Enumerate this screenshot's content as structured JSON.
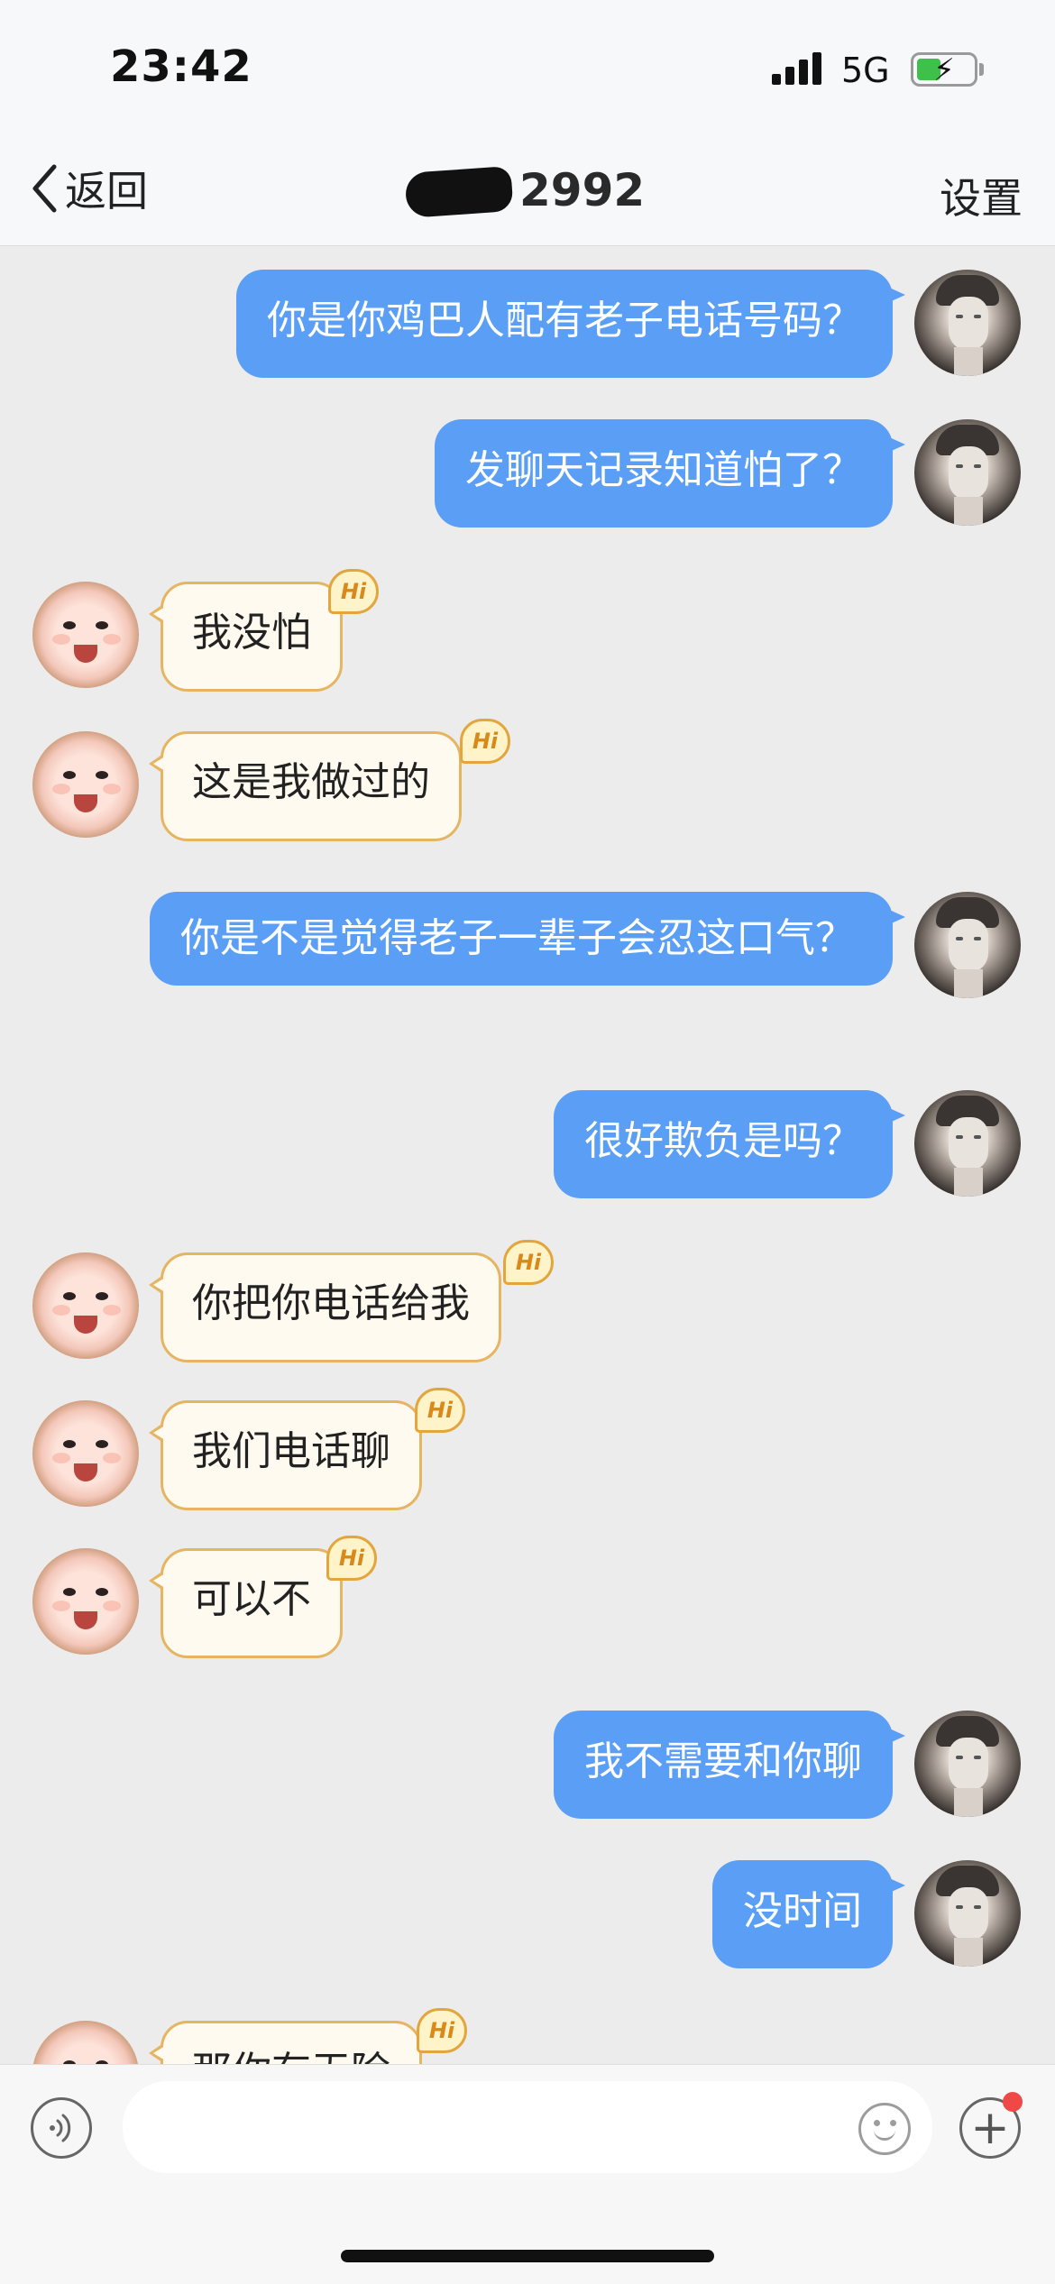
{
  "status_bar": {
    "time": "23:42",
    "network": "5G"
  },
  "nav": {
    "back_label": "返回",
    "title": "2992",
    "settings_label": "设置"
  },
  "messages": [
    {
      "side": "out",
      "text": "你是你鸡巴人配有老子电话号码？"
    },
    {
      "side": "out",
      "text": "发聊天记录知道怕了？"
    },
    {
      "side": "in",
      "text": "我没怕"
    },
    {
      "side": "in",
      "text": "这是我做过的"
    },
    {
      "side": "out",
      "text": "你是不是觉得老子一辈子会忍这口气？"
    },
    {
      "side": "out",
      "text": "很好欺负是吗？"
    },
    {
      "side": "in",
      "text": "你把你电话给我"
    },
    {
      "side": "in",
      "text": "我们电话聊"
    },
    {
      "side": "in",
      "text": "可以不"
    },
    {
      "side": "out",
      "text": "我不需要和你聊"
    },
    {
      "side": "out",
      "text": "没时间"
    },
    {
      "side": "in",
      "text": "那你有无除"
    }
  ],
  "badge_text": "Hi",
  "input": {
    "placeholder": ""
  },
  "icons": {
    "voice": "voice-icon",
    "emoji": "emoji-icon",
    "plus": "plus-icon",
    "back": "chevron-left-icon"
  },
  "colors": {
    "outgoing_bubble": "#5a9ff5",
    "incoming_bubble": "#fffaf0",
    "incoming_border": "#e6b562",
    "background": "#ececec"
  }
}
